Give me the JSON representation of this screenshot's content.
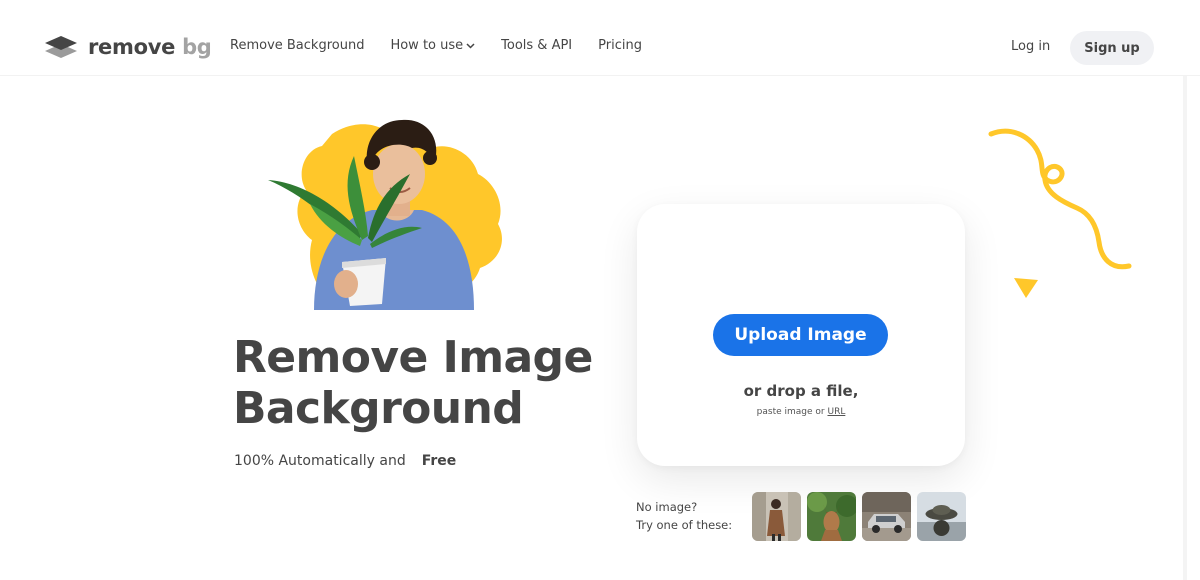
{
  "brand": {
    "name_main": "remove",
    "name_accent": "bg"
  },
  "nav": {
    "items": [
      {
        "label": "Remove Background"
      },
      {
        "label": "How to use"
      },
      {
        "label": "Tools & API"
      },
      {
        "label": "Pricing"
      }
    ]
  },
  "auth": {
    "login_label": "Log in",
    "signup_label": "Sign up"
  },
  "hero": {
    "title_line1": "Remove Image",
    "title_line2": "Background",
    "tagline": "100% Automatically and",
    "badge": "Free"
  },
  "upload": {
    "button_label": "Upload Image",
    "drop_text": "or drop a file,",
    "paste_text": "paste image or",
    "url_link": "URL"
  },
  "samples": {
    "line1": "No image?",
    "line2": "Try one of these:",
    "thumbnails": [
      "person",
      "animal",
      "car",
      "object"
    ]
  },
  "colors": {
    "primary": "#1a73e8",
    "accent_yellow": "#ffc72a",
    "text": "#454545",
    "signup_bg": "#f0f1f4"
  },
  "icons": [
    "logo-layers-icon",
    "chevron-down-icon",
    "squiggle-decoration",
    "triangle-decoration"
  ]
}
